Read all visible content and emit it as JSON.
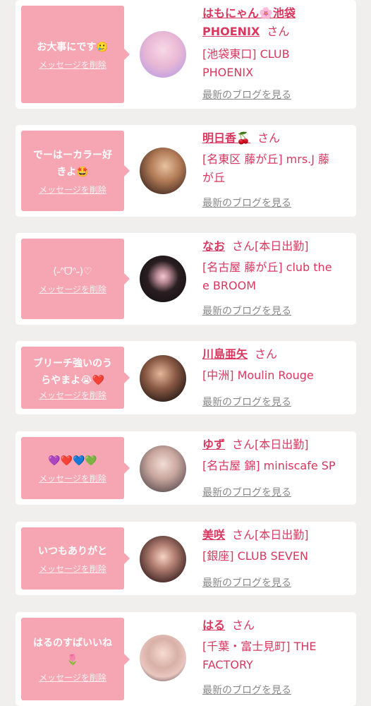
{
  "delete_label": "メッセージを削除",
  "blog_label": "最新のブログを見る",
  "san_label": "さん",
  "items": [
    {
      "message_lines": [
        "お大事にです🥲"
      ],
      "name_lines": [
        "はもにゃん🌸池袋",
        "PHOENIX"
      ],
      "status": "",
      "shop_lines": [
        "[池袋東口] CLUB",
        "PHOENIX"
      ],
      "avatar_icon": "avatar-photo"
    },
    {
      "message_lines": [
        "でーはーカラー好",
        "きよ🤩"
      ],
      "name_lines": [
        "明日香🍒"
      ],
      "status": "",
      "shop_lines": [
        "[名東区 藤が丘] mrs.J 藤",
        "が丘"
      ],
      "avatar_icon": "avatar-photo"
    },
    {
      "message_lines": [
        "(˶ᐢᗜᐢ˶)♡"
      ],
      "name_lines": [
        "なお"
      ],
      "status": "[本日出勤]",
      "shop_lines": [
        "[名古屋 藤が丘] club the",
        "e BROOM"
      ],
      "avatar_icon": "avatar-photo"
    },
    {
      "message_lines": [
        "ブリーチ強いのう",
        "らやまよ😭❤️"
      ],
      "name_lines": [
        "川島亜矢"
      ],
      "status": "",
      "shop_lines": [
        "[中洲] Moulin Rouge"
      ],
      "avatar_icon": "avatar-photo"
    },
    {
      "message_lines": [
        "💜❤️💙💚"
      ],
      "name_lines": [
        "ゆず"
      ],
      "status": "[本日出勤]",
      "shop_lines": [
        "[名古屋 錦] miniscafe SP"
      ],
      "avatar_icon": "avatar-photo"
    },
    {
      "message_lines": [
        "いつもありがと"
      ],
      "name_lines": [
        "美咲"
      ],
      "status": "[本日出勤]",
      "shop_lines": [
        "[銀座] CLUB SEVEN"
      ],
      "avatar_icon": "avatar-photo"
    },
    {
      "message_lines": [
        "はるのすばいいね",
        "🌷"
      ],
      "name_lines": [
        "はる"
      ],
      "status": "",
      "shop_lines": [
        "[千葉・富士見町] THE",
        "FACTORY"
      ],
      "avatar_icon": "avatar-photo"
    }
  ]
}
